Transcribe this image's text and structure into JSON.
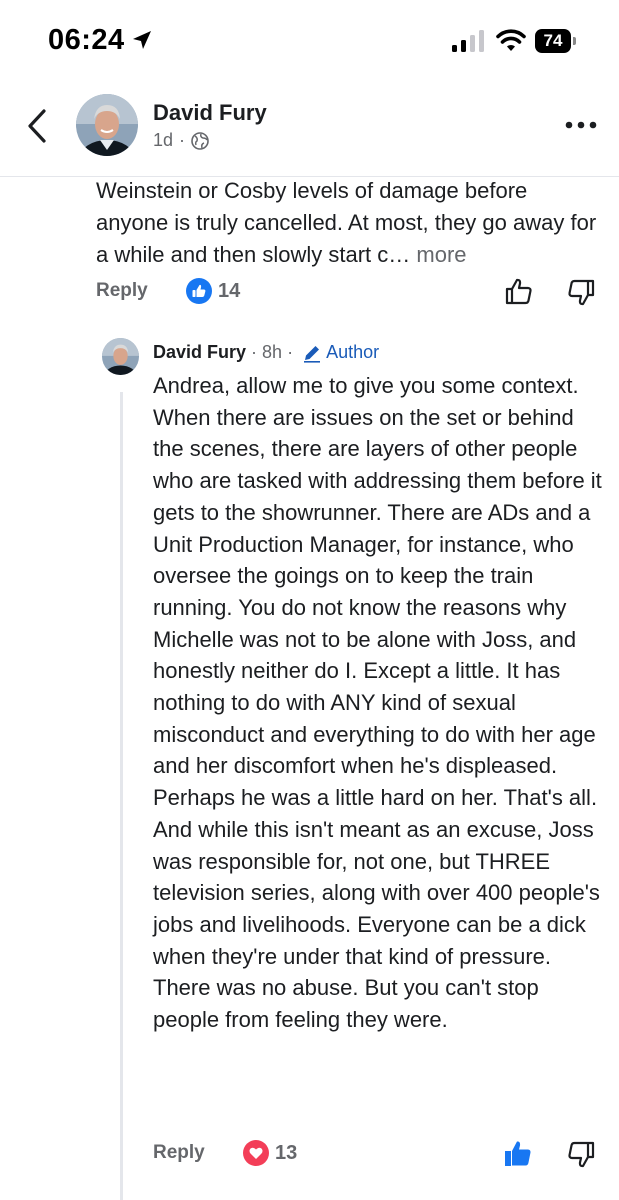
{
  "status_bar": {
    "time": "06:24",
    "battery": "74",
    "icons": [
      "location-arrow-icon",
      "signal-icon",
      "wifi-icon",
      "battery-icon"
    ]
  },
  "post_header": {
    "name": "David Fury",
    "age": "1d",
    "separator": "·",
    "privacy_icon": "globe-icon",
    "back_icon": "chevron-left-icon",
    "more_icon": "more-dots-icon"
  },
  "comment": {
    "text": "Weinstein or Cosby levels of damage before anyone is truly cancelled. At most, they go away for a while and then slowly start c…",
    "more_label": " more",
    "reply_label": "Reply",
    "reaction_icon": "like-icon",
    "reaction_count": "14",
    "like_icon": "thumbs-up-outline-icon",
    "dislike_icon": "thumbs-down-outline-icon"
  },
  "reply": {
    "name": "David Fury",
    "time": "8h",
    "separator": "·",
    "badge": "Author",
    "text": "Andrea, allow me to give you some context. When there are issues on the set or behind the scenes, there are layers of other people who are tasked with addressing them before it gets to the showrunner. There are ADs and a Unit Production Manager, for instance, who oversee the goings on to keep the train running. You do not know the reasons why Michelle was not to be alone with Joss, and honestly neither do I. Except a little. It has nothing to do with ANY kind of sexual misconduct and everything to do with her age and her discomfort when he's displeased. Perhaps he was a little hard on her. That's all. And while this isn't meant as an excuse, Joss was responsible for, not one, but THREE  television series, along with over 400 people's jobs and livelihoods. Everyone can be a dick when they're under that kind of pressure. There was no abuse. But you can't stop people from feeling they were.",
    "reply_label": "Reply",
    "reaction_icon": "love-heart-icon",
    "reaction_count": "13",
    "like_icon": "thumbs-up-filled-icon",
    "dislike_icon": "thumbs-down-outline-icon"
  },
  "colors": {
    "like_blue": "#1877f2",
    "love_red": "#f33e58",
    "author_blue": "#1a5bb8",
    "secondary_text": "#65676b"
  }
}
